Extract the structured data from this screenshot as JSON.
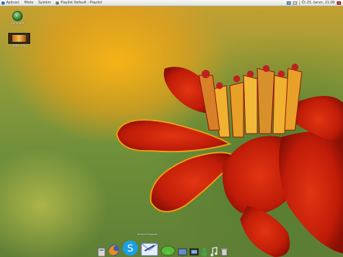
{
  "top_panel": {
    "menus": [
      {
        "label": "Aplicaci",
        "icon": "app-menu-icon",
        "color": "#3a6ab0"
      },
      {
        "label": "Miste",
        "icon": "",
        "color": ""
      },
      {
        "label": "Systém",
        "icon": "",
        "color": ""
      },
      {
        "label": "Playlist Default - Playlist",
        "icon": "audio-player-icon",
        "color": "#777777"
      }
    ],
    "clock": "Čt 23. červn, 21:09"
  },
  "desktop_icons": [
    {
      "label": "Computer",
      "icon": "globe-icon"
    },
    {
      "label": "Video 1.flv",
      "icon": "video-file-icon"
    }
  ],
  "dock": {
    "tooltip": "Internet Explorer",
    "items": [
      {
        "name": "files-dock-icon"
      },
      {
        "name": "firefox-dock-icon"
      },
      {
        "name": "skype-dock-icon"
      },
      {
        "name": "mail-dock-icon"
      },
      {
        "name": "chat-dock-icon"
      },
      {
        "name": "desktop-dock-icon"
      },
      {
        "name": "monitor-dock-icon"
      },
      {
        "name": "user-dock-icon"
      },
      {
        "name": "music-dock-icon"
      },
      {
        "name": "trash-dock-icon"
      }
    ]
  },
  "colors": {
    "panel": "#eeeeea",
    "accent": "#3a6ab0",
    "flower_red": "#c81e0a",
    "flower_orange": "#f0a010"
  }
}
